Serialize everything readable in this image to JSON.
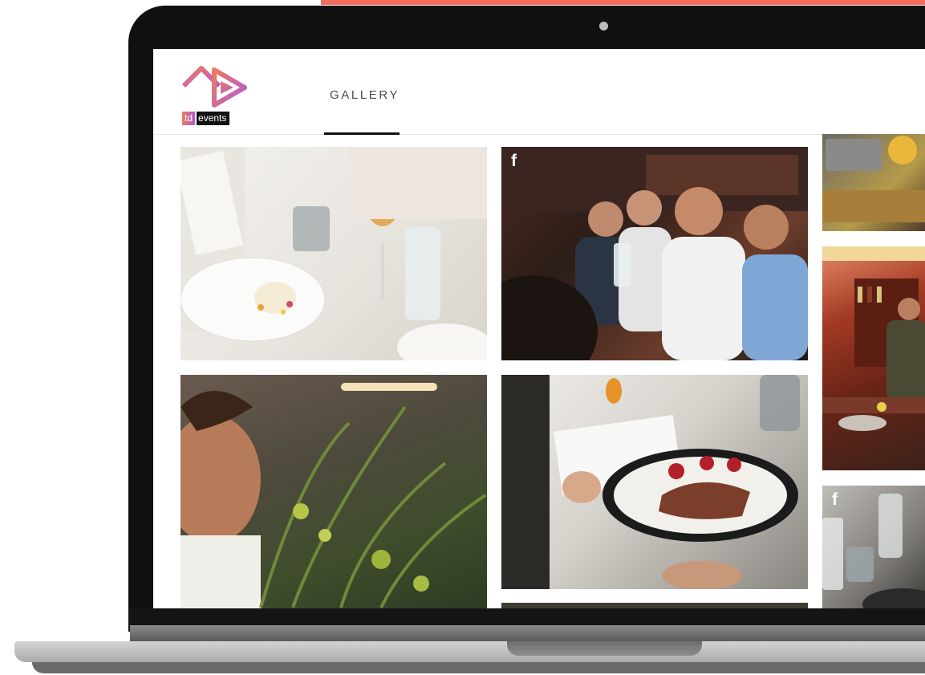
{
  "brand": {
    "logo_word_td": "td",
    "logo_word_events": "events",
    "colors": {
      "accent_bar": "#f26d5b",
      "logo_orange": "#f07b5a",
      "logo_purple": "#b05ad8"
    }
  },
  "nav": {
    "gallery_label": "GALLERY"
  },
  "gallery": {
    "facebook_glyph": "f"
  }
}
